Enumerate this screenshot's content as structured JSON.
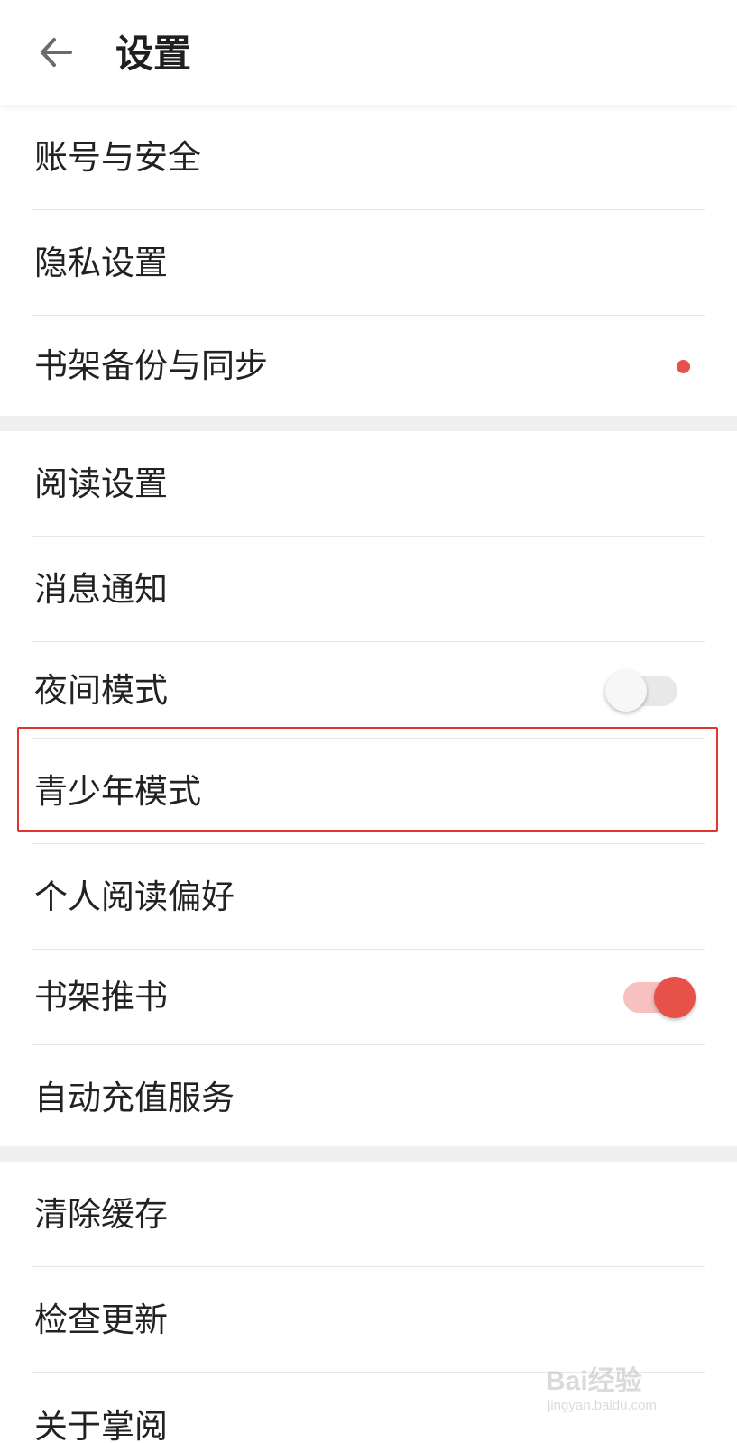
{
  "header": {
    "back_icon": "arrow-left-icon",
    "title": "设置"
  },
  "groups": [
    {
      "items": [
        {
          "label": "账号与安全"
        },
        {
          "label": "隐私设置"
        },
        {
          "label": "书架备份与同步",
          "badge": "red-dot"
        }
      ]
    },
    {
      "items": [
        {
          "label": "阅读设置"
        },
        {
          "label": "消息通知"
        },
        {
          "label": "夜间模式",
          "toggle": "off"
        },
        {
          "label": "青少年模式",
          "highlighted": true
        },
        {
          "label": "个人阅读偏好"
        },
        {
          "label": "书架推书",
          "toggle": "on"
        },
        {
          "label": "自动充值服务"
        }
      ]
    },
    {
      "items": [
        {
          "label": "清除缓存"
        },
        {
          "label": "检查更新"
        },
        {
          "label": "关于掌阅"
        }
      ]
    }
  ],
  "watermark": {
    "brand": "Bai经验",
    "site": "jingyan.baidu.com"
  },
  "colors": {
    "accent": "#e8504a",
    "highlight_border": "#e0342e",
    "divider": "#e6e6e6",
    "section_gap": "#efefef"
  }
}
